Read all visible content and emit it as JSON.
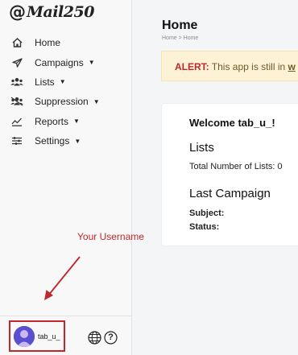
{
  "logo": {
    "at_symbol": "@",
    "text": "Mail250"
  },
  "sidebar": {
    "items": [
      {
        "label": "Home",
        "icon": "home-icon",
        "has_dropdown": false
      },
      {
        "label": "Campaigns",
        "icon": "send-icon",
        "has_dropdown": true
      },
      {
        "label": "Lists",
        "icon": "users-icon",
        "has_dropdown": true
      },
      {
        "label": "Suppression",
        "icon": "user-block-icon",
        "has_dropdown": true
      },
      {
        "label": "Reports",
        "icon": "chart-icon",
        "has_dropdown": true
      },
      {
        "label": "Settings",
        "icon": "sliders-icon",
        "has_dropdown": true
      }
    ]
  },
  "annotation": {
    "text": "Your Username",
    "color": "#c0272d"
  },
  "user": {
    "name": "tab_u_"
  },
  "footer": {
    "help_symbol": "?"
  },
  "main": {
    "title": "Home",
    "breadcrumb": "Home > Home",
    "alert": {
      "strong": "ALERT:",
      "text": " This app is still in ",
      "link_partial": "w"
    },
    "card": {
      "welcome": "Welcome tab_u_!",
      "lists_title": "Lists",
      "lists_text": "Total Number of Lists: 0",
      "campaign_title": "Last Campaign",
      "subject_label": "Subject:",
      "status_label": "Status:"
    }
  },
  "colors": {
    "accent_red": "#c0272d",
    "alert_bg": "#fdf2d6",
    "avatar_bg": "#5a4fcf"
  }
}
